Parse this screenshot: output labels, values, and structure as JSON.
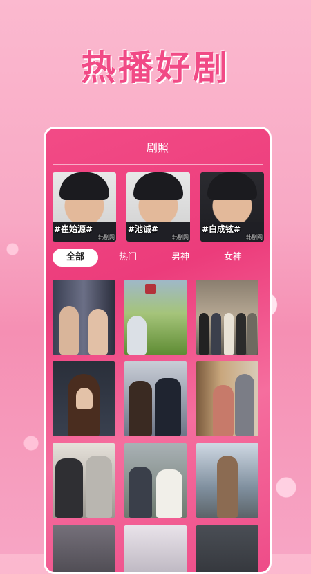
{
  "hero_title": "热播好剧",
  "card_title": "剧照",
  "actors": [
    {
      "name": "#崔始源#",
      "watermark": "韩剧网"
    },
    {
      "name": "#池诚#",
      "watermark": "韩剧网"
    },
    {
      "name": "#白成铉#",
      "watermark": "韩剧网"
    }
  ],
  "tabs": [
    "全部",
    "热门",
    "男神",
    "女神"
  ],
  "active_tab": "全部",
  "colors": {
    "accent": "#ee3f7d",
    "hero": "#f14a86"
  }
}
